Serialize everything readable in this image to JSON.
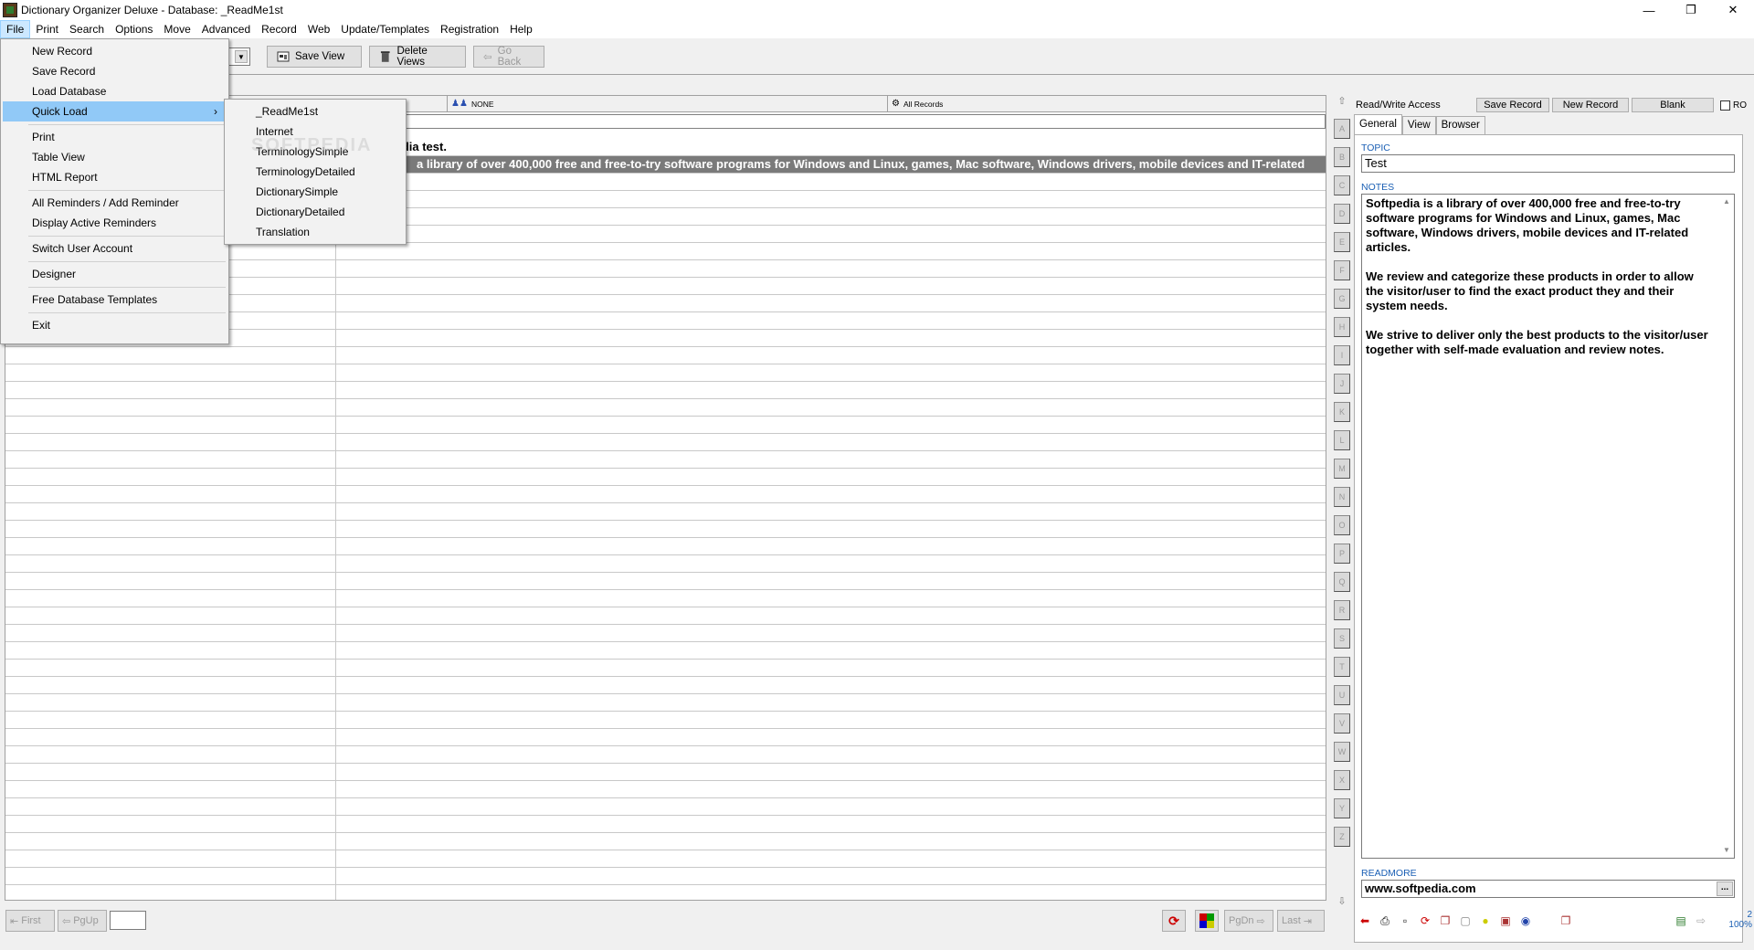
{
  "window": {
    "title": "Dictionary Organizer Deluxe - Database: _ReadMe1st"
  },
  "menubar": [
    "File",
    "Print",
    "Search",
    "Options",
    "Move",
    "Advanced",
    "Record",
    "Web",
    "Update/Templates",
    "Registration",
    "Help"
  ],
  "toolbar": {
    "save_view": "Save View",
    "delete_views": "Delete Views",
    "go_back": "Go Back"
  },
  "grid": {
    "col2_header": "NONE",
    "col3_header": "All Records",
    "rows": [
      {
        "text": "Softpedia test.",
        "visible": "ftpedia test."
      },
      {
        "text": "Softpedia is a library of over 400,000 free and free-to-try software programs for Windows and Linux, games, Mac software, Windows drivers, mobile devices and IT-related",
        "visible": "a library of over 400,000 free and free-to-try software programs for Windows and Linux, games, Mac software, Windows drivers, mobile devices and IT-related"
      }
    ]
  },
  "alphabet": [
    "A",
    "B",
    "C",
    "D",
    "E",
    "F",
    "G",
    "H",
    "I",
    "J",
    "K",
    "L",
    "M",
    "N",
    "O",
    "P",
    "Q",
    "R",
    "S",
    "T",
    "U",
    "V",
    "W",
    "X",
    "Y",
    "Z"
  ],
  "right_panel": {
    "access": "Read/Write Access",
    "save_record": "Save Record",
    "new_record": "New Record",
    "blank": "Blank",
    "ro_label": "RO",
    "tabs": [
      "General",
      "View",
      "Browser"
    ],
    "topic_label": "TOPIC",
    "topic_value": "Test",
    "notes_label": "NOTES",
    "notes": [
      "Softpedia is a library of over 400,000 free and free-to-try software programs for Windows and Linux, games, Mac software, Windows drivers, mobile devices and IT-related articles.",
      "We review and categorize these products in order to allow the visitor/user to find the exact product they and their system needs.",
      "We strive to deliver only the best products to the visitor/user together with self-made evaluation and review notes."
    ],
    "readmore_label": "READMORE",
    "readmore_value": "www.softpedia.com",
    "readmore_button": "...",
    "zoom_top": "2",
    "zoom": "100%"
  },
  "bottom_nav": {
    "first": "First",
    "pgup": "PgUp",
    "pgdn": "PgDn",
    "last": "Last"
  },
  "file_menu": {
    "items": [
      "New Record",
      "Save Record",
      "Load Database",
      "Quick Load",
      "Print",
      "Table View",
      "HTML Report",
      "All Reminders / Add Reminder",
      "Display Active Reminders",
      "Switch User Account",
      "Designer",
      "Free Database Templates",
      "Exit"
    ],
    "submenu_arrow": "›"
  },
  "quick_load_submenu": [
    "_ReadMe1st",
    "Internet",
    "TerminologySimple",
    "TerminologyDetailed",
    "DictionarySimple",
    "DictionaryDetailed",
    "Translation"
  ],
  "watermark": "SOFTPEDIA",
  "colors": {
    "highlight": "#91c9f7",
    "label_blue": "#1a5fb4",
    "selected_row": "#7a7a7a"
  }
}
